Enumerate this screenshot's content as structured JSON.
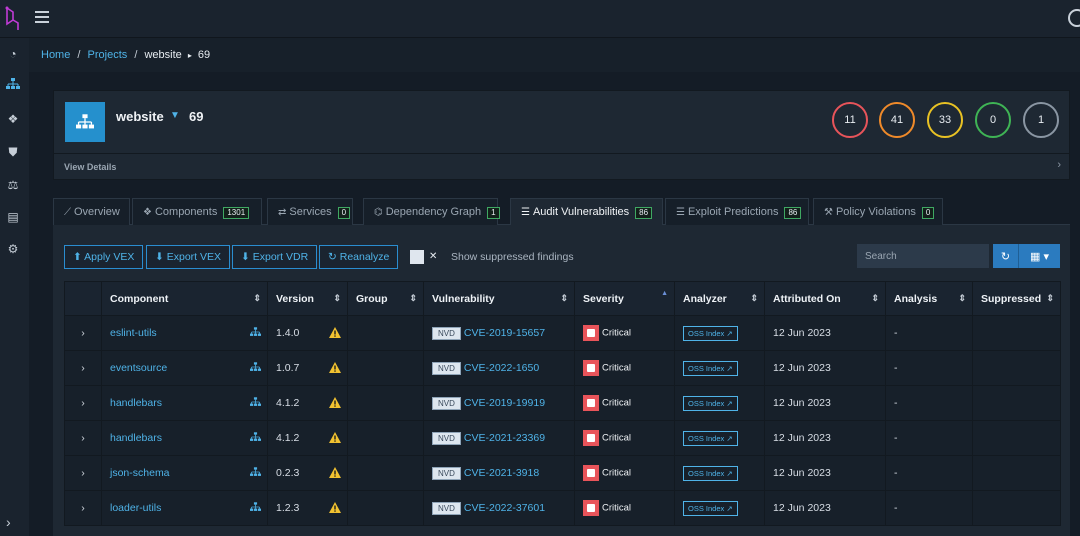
{
  "breadcrumb": {
    "home": "Home",
    "projects": "Projects",
    "project": "website",
    "version": "69"
  },
  "project": {
    "name": "website",
    "version": "69",
    "view_details": "View Details"
  },
  "severity_counts": [
    {
      "value": "11",
      "color": "#e8545a"
    },
    {
      "value": "41",
      "color": "#ef8a2a"
    },
    {
      "value": "33",
      "color": "#e8c224"
    },
    {
      "value": "0",
      "color": "#3fb455"
    },
    {
      "value": "1",
      "color": "#8a96a3"
    }
  ],
  "tabs": [
    {
      "label": "Overview",
      "icon": "line-chart-icon"
    },
    {
      "label": "Components",
      "badge": "1301",
      "icon": "cubes-icon"
    },
    {
      "label": "Services",
      "badge": "0",
      "icon": "exchange-icon"
    },
    {
      "label": "Dependency Graph",
      "badge": "1",
      "icon": "sitemap-icon"
    },
    {
      "label": "Audit Vulnerabilities",
      "badge": "86",
      "icon": "tasks-icon"
    },
    {
      "label": "Exploit Predictions",
      "badge": "86",
      "icon": "tasks-icon"
    },
    {
      "label": "Policy Violations",
      "badge": "0",
      "icon": "gavel-icon"
    }
  ],
  "toolbar": {
    "apply_vex": "Apply VEX",
    "export_vex": "Export VEX",
    "export_vdr": "Export VDR",
    "reanalyze": "Reanalyze",
    "show_suppressed": "Show suppressed findings",
    "checkbox_mark": "✕",
    "search_placeholder": "Search"
  },
  "table": {
    "headers": [
      "Component",
      "Version",
      "Group",
      "Vulnerability",
      "Severity",
      "Analyzer",
      "Attributed On",
      "Analysis",
      "Suppressed"
    ],
    "rows": [
      {
        "component": "eslint-utils",
        "version": "1.4.0",
        "group": "",
        "source": "NVD",
        "vuln": "CVE-2019-15657",
        "severity": "Critical",
        "analyzer": "OSS Index",
        "attributed": "12 Jun 2023",
        "analysis": "-",
        "suppressed": ""
      },
      {
        "component": "eventsource",
        "version": "1.0.7",
        "group": "",
        "source": "NVD",
        "vuln": "CVE-2022-1650",
        "severity": "Critical",
        "analyzer": "OSS Index",
        "attributed": "12 Jun 2023",
        "analysis": "-",
        "suppressed": ""
      },
      {
        "component": "handlebars",
        "version": "4.1.2",
        "group": "",
        "source": "NVD",
        "vuln": "CVE-2019-19919",
        "severity": "Critical",
        "analyzer": "OSS Index",
        "attributed": "12 Jun 2023",
        "analysis": "-",
        "suppressed": ""
      },
      {
        "component": "handlebars",
        "version": "4.1.2",
        "group": "",
        "source": "NVD",
        "vuln": "CVE-2021-23369",
        "severity": "Critical",
        "analyzer": "OSS Index",
        "attributed": "12 Jun 2023",
        "analysis": "-",
        "suppressed": ""
      },
      {
        "component": "json-schema",
        "version": "0.2.3",
        "group": "",
        "source": "NVD",
        "vuln": "CVE-2021-3918",
        "severity": "Critical",
        "analyzer": "OSS Index",
        "attributed": "12 Jun 2023",
        "analysis": "-",
        "suppressed": ""
      },
      {
        "component": "loader-utils",
        "version": "1.2.3",
        "group": "",
        "source": "NVD",
        "vuln": "CVE-2022-37601",
        "severity": "Critical",
        "analyzer": "OSS Index",
        "attributed": "12 Jun 2023",
        "analysis": "-",
        "suppressed": ""
      }
    ]
  }
}
